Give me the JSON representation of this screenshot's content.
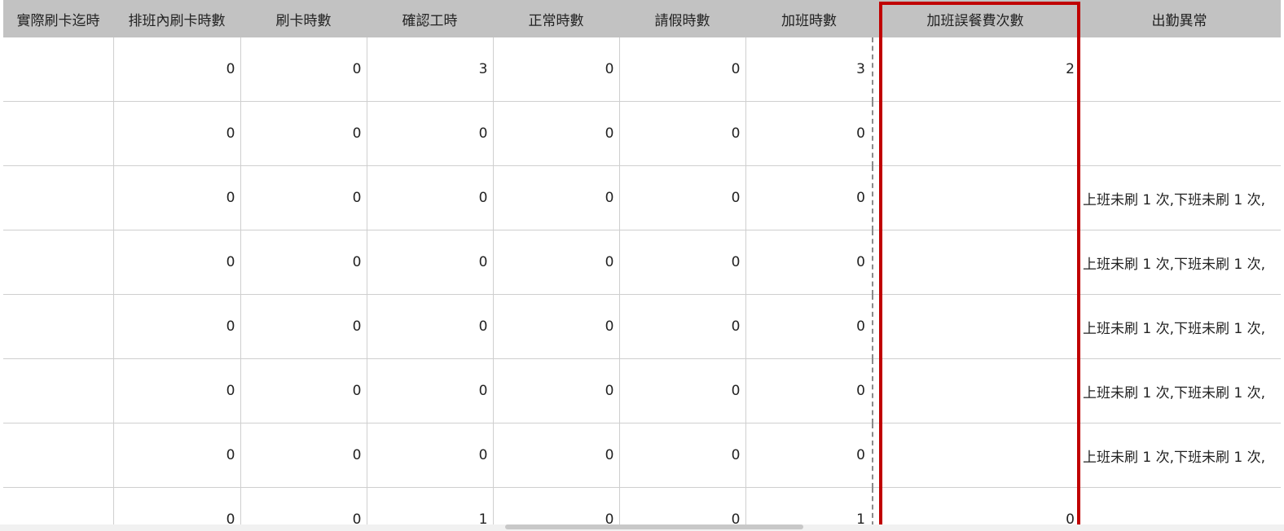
{
  "table": {
    "columns": [
      "實際刷卡迄時",
      "排班內刷卡時數",
      "刷卡時數",
      "確認工時",
      "正常時數",
      "請假時數",
      "加班時數",
      "加班誤餐費次數",
      "出勤異常"
    ],
    "rows": [
      [
        "",
        "0",
        "0",
        "3",
        "0",
        "0",
        "3",
        "2",
        ""
      ],
      [
        "",
        "0",
        "0",
        "0",
        "0",
        "0",
        "0",
        "",
        ""
      ],
      [
        "",
        "0",
        "0",
        "0",
        "0",
        "0",
        "0",
        "",
        "上班未刷 1 次,下班未刷 1 次,"
      ],
      [
        "",
        "0",
        "0",
        "0",
        "0",
        "0",
        "0",
        "",
        "上班未刷 1 次,下班未刷 1 次,"
      ],
      [
        "",
        "0",
        "0",
        "0",
        "0",
        "0",
        "0",
        "",
        "上班未刷 1 次,下班未刷 1 次,"
      ],
      [
        "",
        "0",
        "0",
        "0",
        "0",
        "0",
        "0",
        "",
        "上班未刷 1 次,下班未刷 1 次,"
      ],
      [
        "",
        "0",
        "0",
        "0",
        "0",
        "0",
        "0",
        "",
        "上班未刷 1 次,下班未刷 1 次,"
      ],
      [
        "",
        "0",
        "0",
        "1",
        "0",
        "0",
        "1",
        "0",
        ""
      ]
    ]
  },
  "colors": {
    "header_bg": "#c2c2c2",
    "highlight": "#c00000",
    "gridline": "#cfcfcf"
  }
}
